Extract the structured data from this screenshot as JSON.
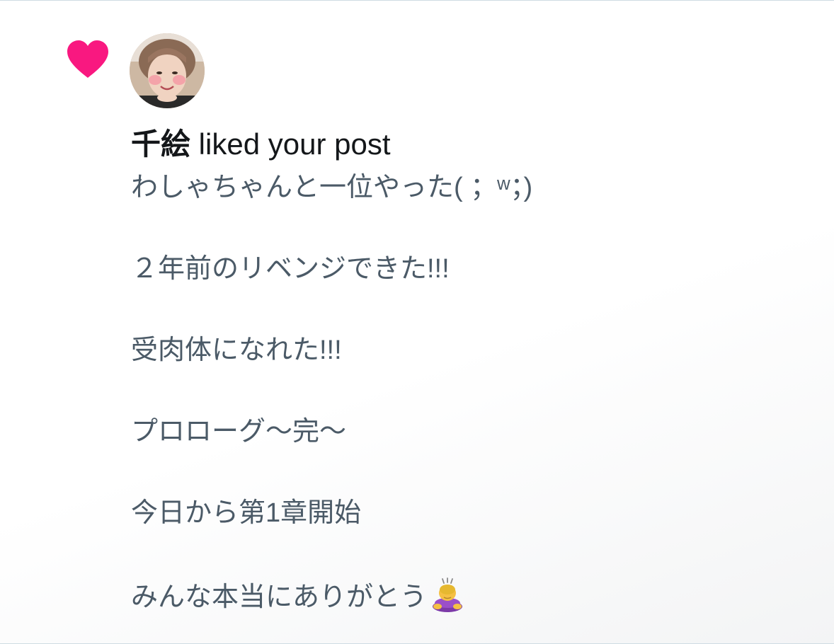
{
  "notification": {
    "type_icon": "heart-icon",
    "accent_color": "#f91880",
    "user_name": "千絵",
    "action_text": " liked your post",
    "post_lines": [
      "わしゃちゃんと一位やった( ；ʷ；)",
      "２年前のリベンジできた!!!",
      "受肉体になれた!!!",
      "プロローグ〜完〜",
      "今日から第1章開始",
      "みんな本当にありがとう"
    ],
    "trailing_emoji": "person-bowing-icon"
  }
}
